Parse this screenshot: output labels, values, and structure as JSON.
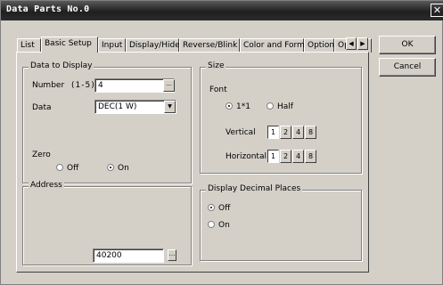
{
  "window": {
    "title": "Data Parts No.0",
    "close_glyph": "✕"
  },
  "tabs": [
    {
      "label": "List",
      "active": false
    },
    {
      "label": "Basic Setup",
      "active": true
    },
    {
      "label": "Input",
      "active": false
    },
    {
      "label": "Display/Hide",
      "active": false
    },
    {
      "label": "Reverse/Blink",
      "active": false
    },
    {
      "label": "Color and Form",
      "active": false
    },
    {
      "label": "Option",
      "active": false
    },
    {
      "label": "Op",
      "active": false
    }
  ],
  "tab_scroll": {
    "left_icon": "◀",
    "right_icon": "▶"
  },
  "buttons": {
    "ok": "OK",
    "cancel": "Cancel"
  },
  "data_to_display": {
    "title": "Data to Display",
    "number_label": "Number",
    "number_range": "(1-5)",
    "number_value": "4",
    "number_browse": "...",
    "data_label": "Data",
    "data_selected": "DEC(1 W)",
    "dropdown_icon": "▼"
  },
  "zero": {
    "label": "Zero",
    "off": "Off",
    "on": "On",
    "selected": "On"
  },
  "address": {
    "title": "Address",
    "value": "40200",
    "browse": "…"
  },
  "size": {
    "title": "Size",
    "font_label": "Font",
    "font_options": [
      "1*1",
      "Half"
    ],
    "font_selected": "1*1",
    "vertical_label": "Vertical",
    "horizontal_label": "Horizontal",
    "scales": [
      "1",
      "2",
      "4",
      "8"
    ],
    "vertical_selected": "1",
    "horizontal_selected": "1"
  },
  "decimal": {
    "title": "Display Decimal Places",
    "off": "Off",
    "on": "On",
    "selected": "Off"
  }
}
